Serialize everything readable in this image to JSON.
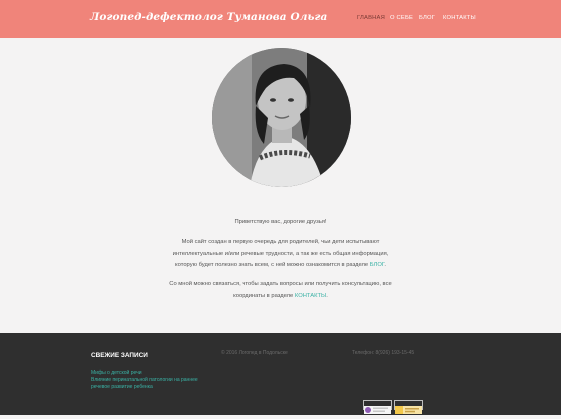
{
  "header": {
    "site_title": "Логопед-дефектолог Туманова Ольга",
    "nav": [
      "ГЛАВНАЯ",
      "О СЕБЕ",
      "БЛОГ",
      "КОНТАКТЫ"
    ]
  },
  "intro": {
    "greeting": "Приветствую вас, дорогие друзья!",
    "p1_line1": "Мой сайт создан в первую очередь для родителей, чьи дети испытывают",
    "p1_line2": "интеллектуальные и/или речевые трудности, а так же есть общая информация,",
    "p1_line3_before": "которую будет полезно знать всем, с ней можно ознакомится  в разделе ",
    "p1_link": "БЛОГ",
    "p1_line3_after": ".",
    "p2_line1": "Со мной можно связаться, чтобы задать  вопросы или получить консультацию, все",
    "p2_line2_before": "координаты в разделе ",
    "p2_link": "КОНТАКТЫ",
    "p2_line2_after": "."
  },
  "footer": {
    "recent_heading": "СВЕЖИЕ ЗАПИСИ",
    "recent_posts": [
      "Мифы о детской речи",
      "Влияние перинатальной патологии на раннее",
      "речевое развитие ребенка"
    ],
    "copyright": "© 2016 Логопед в Подольске",
    "phone": "Телефон: 8(926) 193-15-45"
  },
  "colors": {
    "header_bg": "#f0847a",
    "link": "#3ab2a5",
    "footer_bg": "#2f2f2f"
  },
  "icons": [
    "portrait-photo",
    "liveinternet-counter-icon",
    "yandex-metrika-counter-icon"
  ]
}
